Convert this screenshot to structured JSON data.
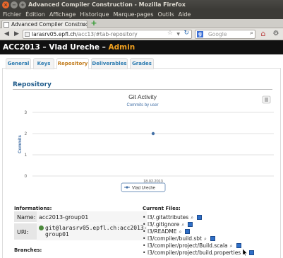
{
  "window": {
    "title": "Advanced Compiler Construction - Mozilla Firefox"
  },
  "menu": [
    "Fichier",
    "Édition",
    "Affichage",
    "Historique",
    "Marque-pages",
    "Outils",
    "Aide"
  ],
  "browser_tab": {
    "title": "Advanced Compiler Constructi..."
  },
  "urlbar": {
    "host": "larasrv05.epfl.ch",
    "path": "/acc13/#tab-repository"
  },
  "search": {
    "placeholder": "Google"
  },
  "page": {
    "header_main": "ACC2013 – Vlad Ureche – ",
    "header_role": "Admin",
    "tabs": [
      "General",
      "Keys",
      "Repository",
      "Deliverables",
      "Grades"
    ],
    "active_tab": "Repository",
    "section_title": "Repository"
  },
  "chart_data": {
    "type": "line",
    "title": "Git Activity",
    "subtitle": "Commits by user",
    "ylabel": "Commits",
    "xlabel": "",
    "ylim": [
      0,
      3
    ],
    "yticks": [
      "0",
      "1",
      "2",
      "3"
    ],
    "categories": [
      "18.02.2013"
    ],
    "series": [
      {
        "name": "Vlad Ureche",
        "values": [
          2
        ],
        "color": "#4572a7"
      }
    ],
    "grid": true,
    "legend": "bottom"
  },
  "info": {
    "title": "Informations:",
    "name_label": "Name:",
    "name_value": "acc2013-group01",
    "uri_label": "URI:",
    "uri_line1": "git@larasrv05.epfl.ch:acc2013-",
    "uri_line2": "group01"
  },
  "files_title": "Current Files:",
  "files": [
    "l3/.gitattributes",
    "l3/.gitignore",
    "l3/README",
    "l3/compiler/build.sbt",
    "l3/compiler/project/Build.scala",
    "l3/compiler/project/build.properties"
  ],
  "branches_title": "Branches:"
}
